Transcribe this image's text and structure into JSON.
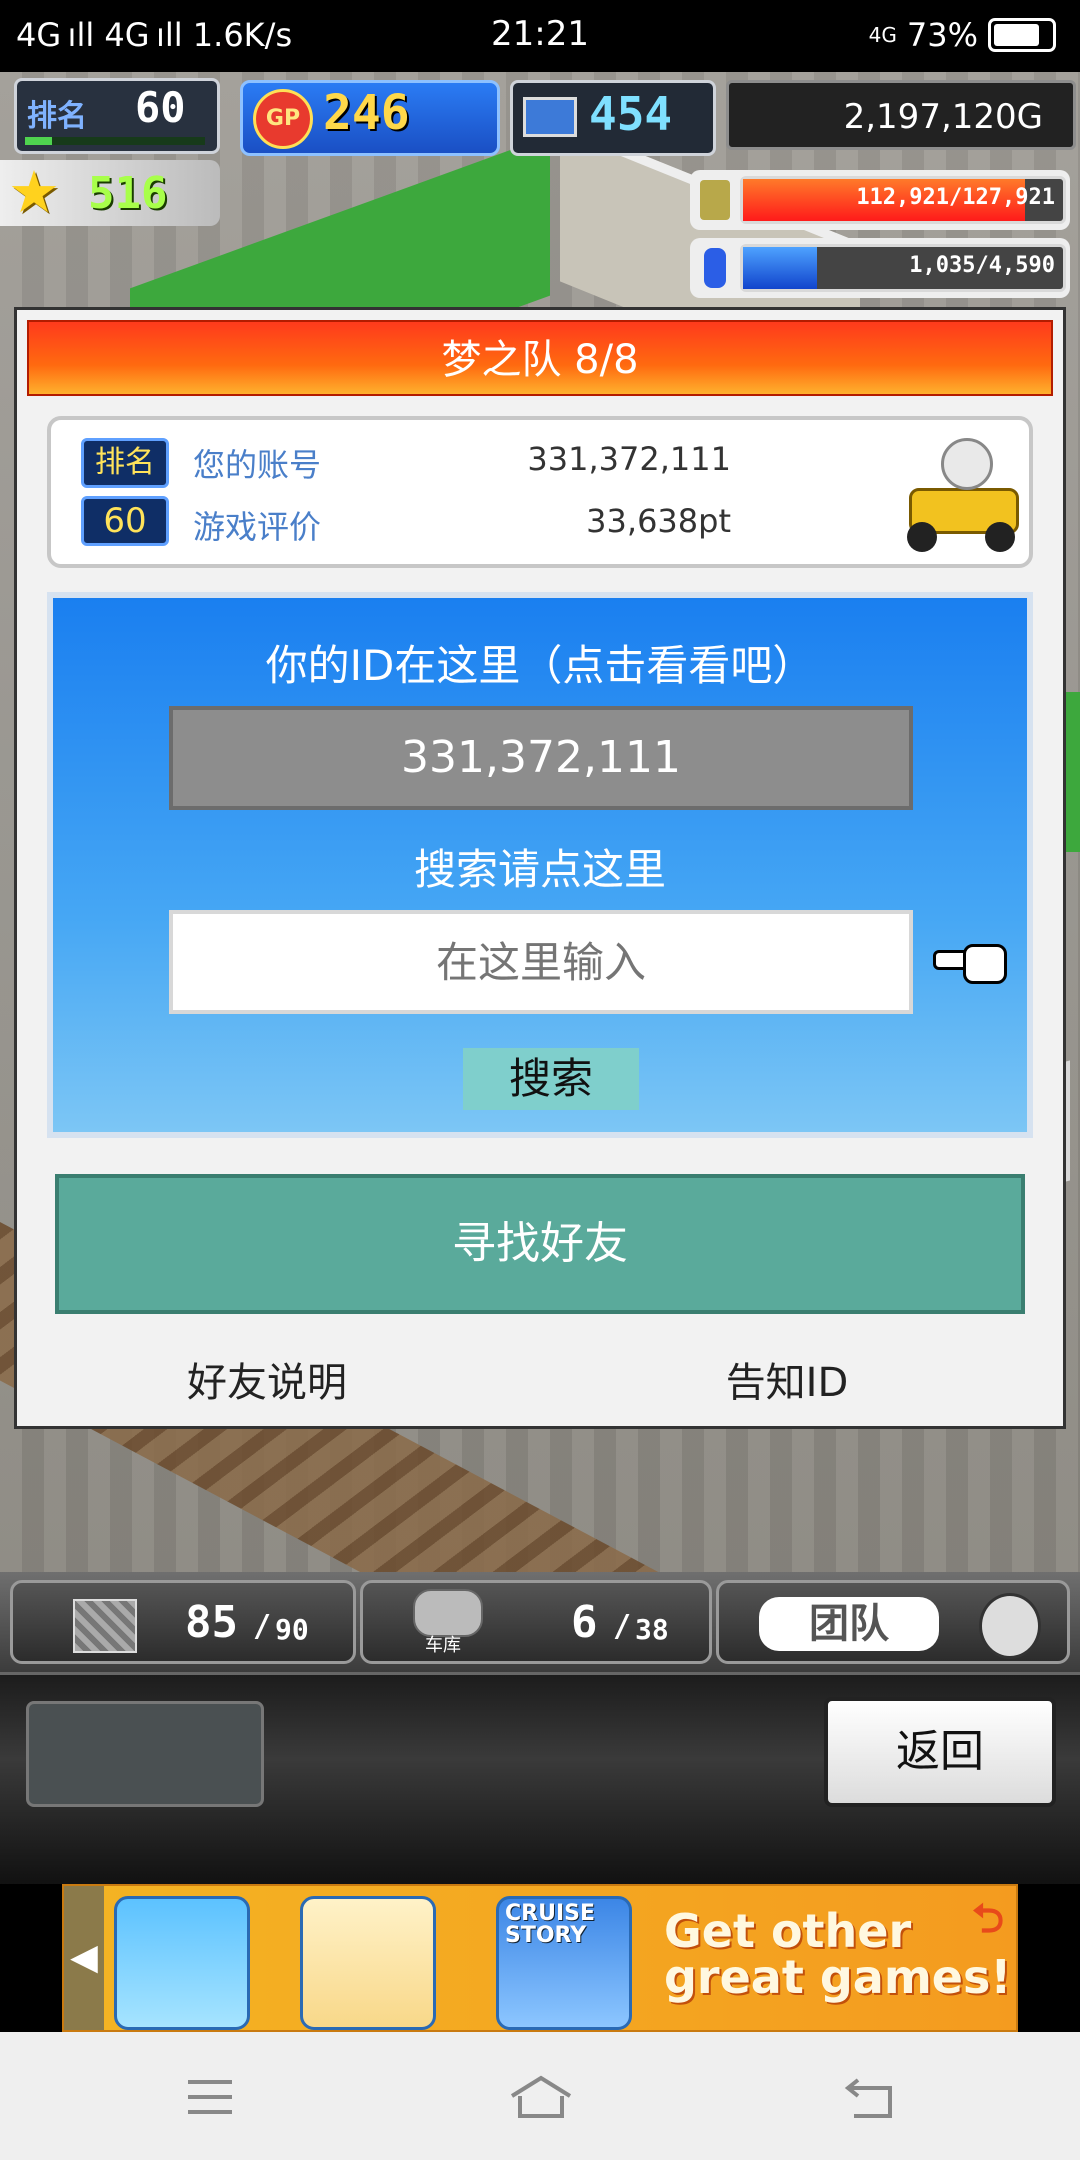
{
  "status_bar": {
    "network": "4G ıll 4G ıll 1.6K/s",
    "time": "21:21",
    "signal": "4G",
    "battery_percent": "73%",
    "battery_level": 0.73
  },
  "hud": {
    "rank_label": "排名",
    "rank_value": "60",
    "gp_label": "GP",
    "gp_value": "246",
    "computer_value": "454",
    "money": "2,197,120G",
    "stars": "516",
    "fuel_bar": "112,921/127,921",
    "fuel_level": 0.88,
    "energy_bar": "1,035/4,590",
    "energy_level": 0.23
  },
  "dialog": {
    "title": "梦之队 8/8",
    "account_card": {
      "rank_label": "排名",
      "rank_value": "60",
      "account_label": "您的账号",
      "account_value": "331,372,111",
      "rating_label": "游戏评价",
      "rating_value": "33,638pt"
    },
    "id_caption": "你的ID在这里（点击看看吧）",
    "id_value": "331,372,111",
    "search_caption": "搜索请点这里",
    "search_placeholder": "在这里输入",
    "search_button": "搜索",
    "find_friends_button": "寻找好友",
    "friend_help_link": "好友说明",
    "share_id_link": "告知ID"
  },
  "bottom_bar": {
    "stat1": "85",
    "stat1_max": "90",
    "garage_label": "车库",
    "stat2": "6",
    "stat2_max": "38",
    "team_label": "团队"
  },
  "controls": {
    "back_button": "返回"
  },
  "ad": {
    "line1": "Get other",
    "line2": "great games!",
    "cruise_label": "CRUISE STORY"
  }
}
